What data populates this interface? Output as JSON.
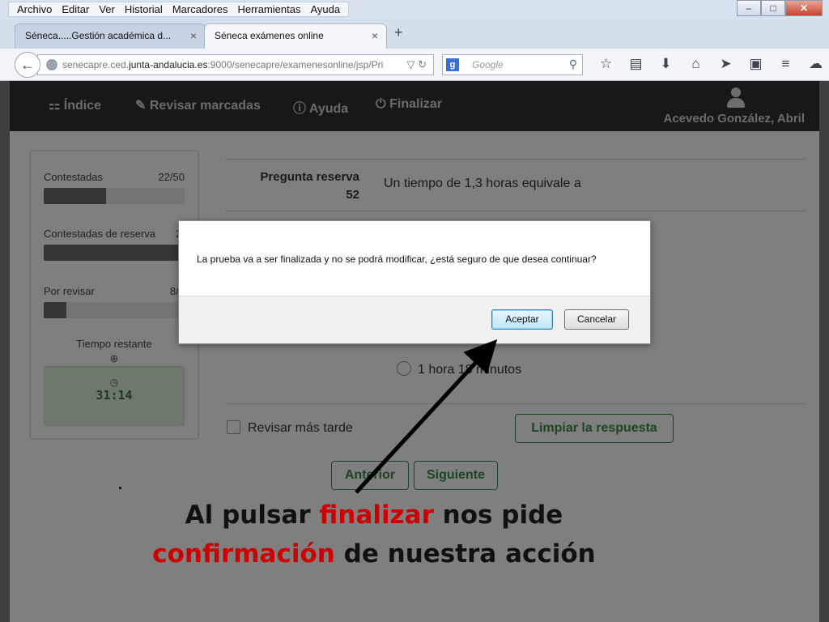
{
  "browser": {
    "menu": [
      "Archivo",
      "Editar",
      "Ver",
      "Historial",
      "Marcadores",
      "Herramientas",
      "Ayuda"
    ],
    "window_controls": [
      "–",
      "□",
      "✕"
    ],
    "tabs": [
      {
        "title": "Séneca.....Gestión académica d...",
        "close": "×"
      },
      {
        "title": "Séneca exámenes online",
        "close": "×"
      }
    ],
    "new_tab": "+",
    "url_prefix": "senecapre.ced.",
    "url_domain": "junta-andalucia.es",
    "url_suffix": ":9000/senecapre/examenesonline/jsp/Pri",
    "search_engine_icon": "g",
    "search_placeholder": "Google",
    "toolbar_icons": [
      "star-icon",
      "clipboard-icon",
      "download-icon",
      "home-icon",
      "send-icon",
      "screenshot-icon",
      "menu-icon",
      "cloud-icon"
    ]
  },
  "app": {
    "nav": {
      "indice": "Índice",
      "revisar": "Revisar marcadas",
      "ayuda": "Ayuda",
      "finalizar": "Finalizar"
    },
    "user_name": "Acevedo González, Abril",
    "stats": [
      {
        "label": "Contestadas",
        "count": "22/50",
        "progress": 0.44
      },
      {
        "label": "Contestadas de reserva",
        "count": "2/",
        "progress": 1.0
      },
      {
        "label": "Por revisar",
        "count": "8/5",
        "progress": 0.16
      }
    ],
    "time_label": "Tiempo restante",
    "timer": "31:14",
    "question_label": "Pregunta reserva",
    "question_number": "52",
    "question_text": "Un tiempo de 1,3 horas equivale a",
    "option_text": "1 hora 18 minutos",
    "review_later": "Revisar más tarde",
    "clear_button": "Limpiar la respuesta",
    "prev_button": "Anterior",
    "next_button": "Siguiente"
  },
  "dialog": {
    "message": "La prueba va a ser finalizada y no se podrá modificar, ¿está seguro de que desea continuar?",
    "accept": "Aceptar",
    "cancel": "Cancelar"
  },
  "caption": {
    "line1_pre": "Al pulsar ",
    "line1_red": "finalizar",
    "line1_post": " nos pide",
    "line2_red": "confirmación",
    "line2_post": " de nuestra acción"
  },
  "colors": {
    "caption_red": "#c00000",
    "nav_bg": "#2d3035",
    "button_green": "#3c8a46",
    "timer_bg": "#dff0d8"
  }
}
